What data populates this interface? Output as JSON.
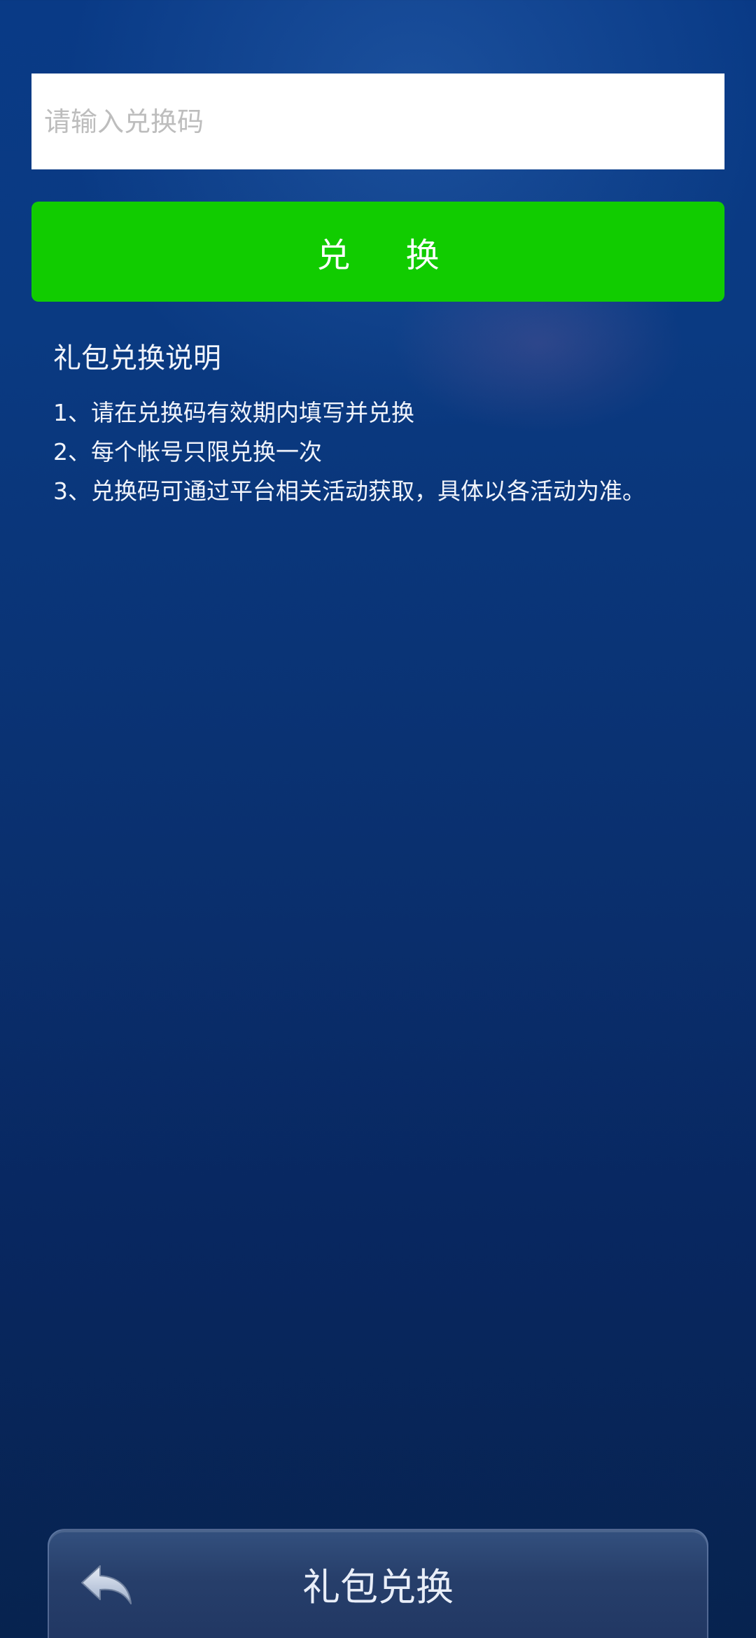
{
  "redeem": {
    "input_placeholder": "请输入兑换码",
    "input_value": "",
    "button_label": "兑 换"
  },
  "instructions": {
    "title": "礼包兑换说明",
    "items": [
      "1、请在兑换码有效期内填写并兑换",
      "2、每个帐号只限兑换一次",
      "3、兑换码可通过平台相关活动获取，具体以各活动为准。"
    ]
  },
  "bottom_bar": {
    "title": "礼包兑换",
    "back_icon": "back-arrow-icon"
  },
  "colors": {
    "button_green": "#11cc00",
    "background": "#0a2f6d"
  }
}
